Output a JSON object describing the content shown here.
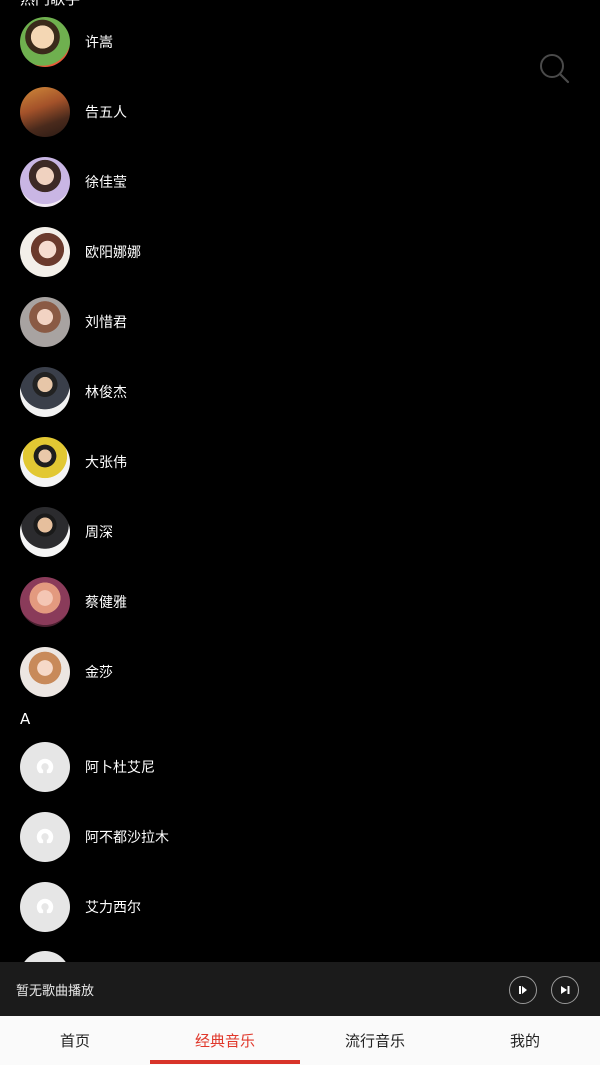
{
  "list": {
    "partial_header": "热门歌手",
    "popular_artists": [
      {
        "name": "许嵩"
      },
      {
        "name": "告五人"
      },
      {
        "name": "徐佳莹"
      },
      {
        "name": "欧阳娜娜"
      },
      {
        "name": "刘惜君"
      },
      {
        "name": "林俊杰"
      },
      {
        "name": "大张伟"
      },
      {
        "name": "周深"
      },
      {
        "name": "蔡健雅"
      },
      {
        "name": "金莎"
      }
    ],
    "section_letter": "A",
    "a_artists": [
      {
        "name": "阿卜杜艾尼"
      },
      {
        "name": "阿不都沙拉木"
      },
      {
        "name": "艾力西尔"
      }
    ]
  },
  "player": {
    "status_text": "暂无歌曲播放",
    "play_icon": "play-icon",
    "next_icon": "next-track-icon"
  },
  "tabs": [
    {
      "label": "首页",
      "active": false
    },
    {
      "label": "经典音乐",
      "active": true
    },
    {
      "label": "流行音乐",
      "active": false
    },
    {
      "label": "我的",
      "active": false
    }
  ],
  "colors": {
    "accent": "#e0382b",
    "background": "#000000",
    "player_bg": "#1b1b1b",
    "tabbar_bg": "#fafafa"
  }
}
